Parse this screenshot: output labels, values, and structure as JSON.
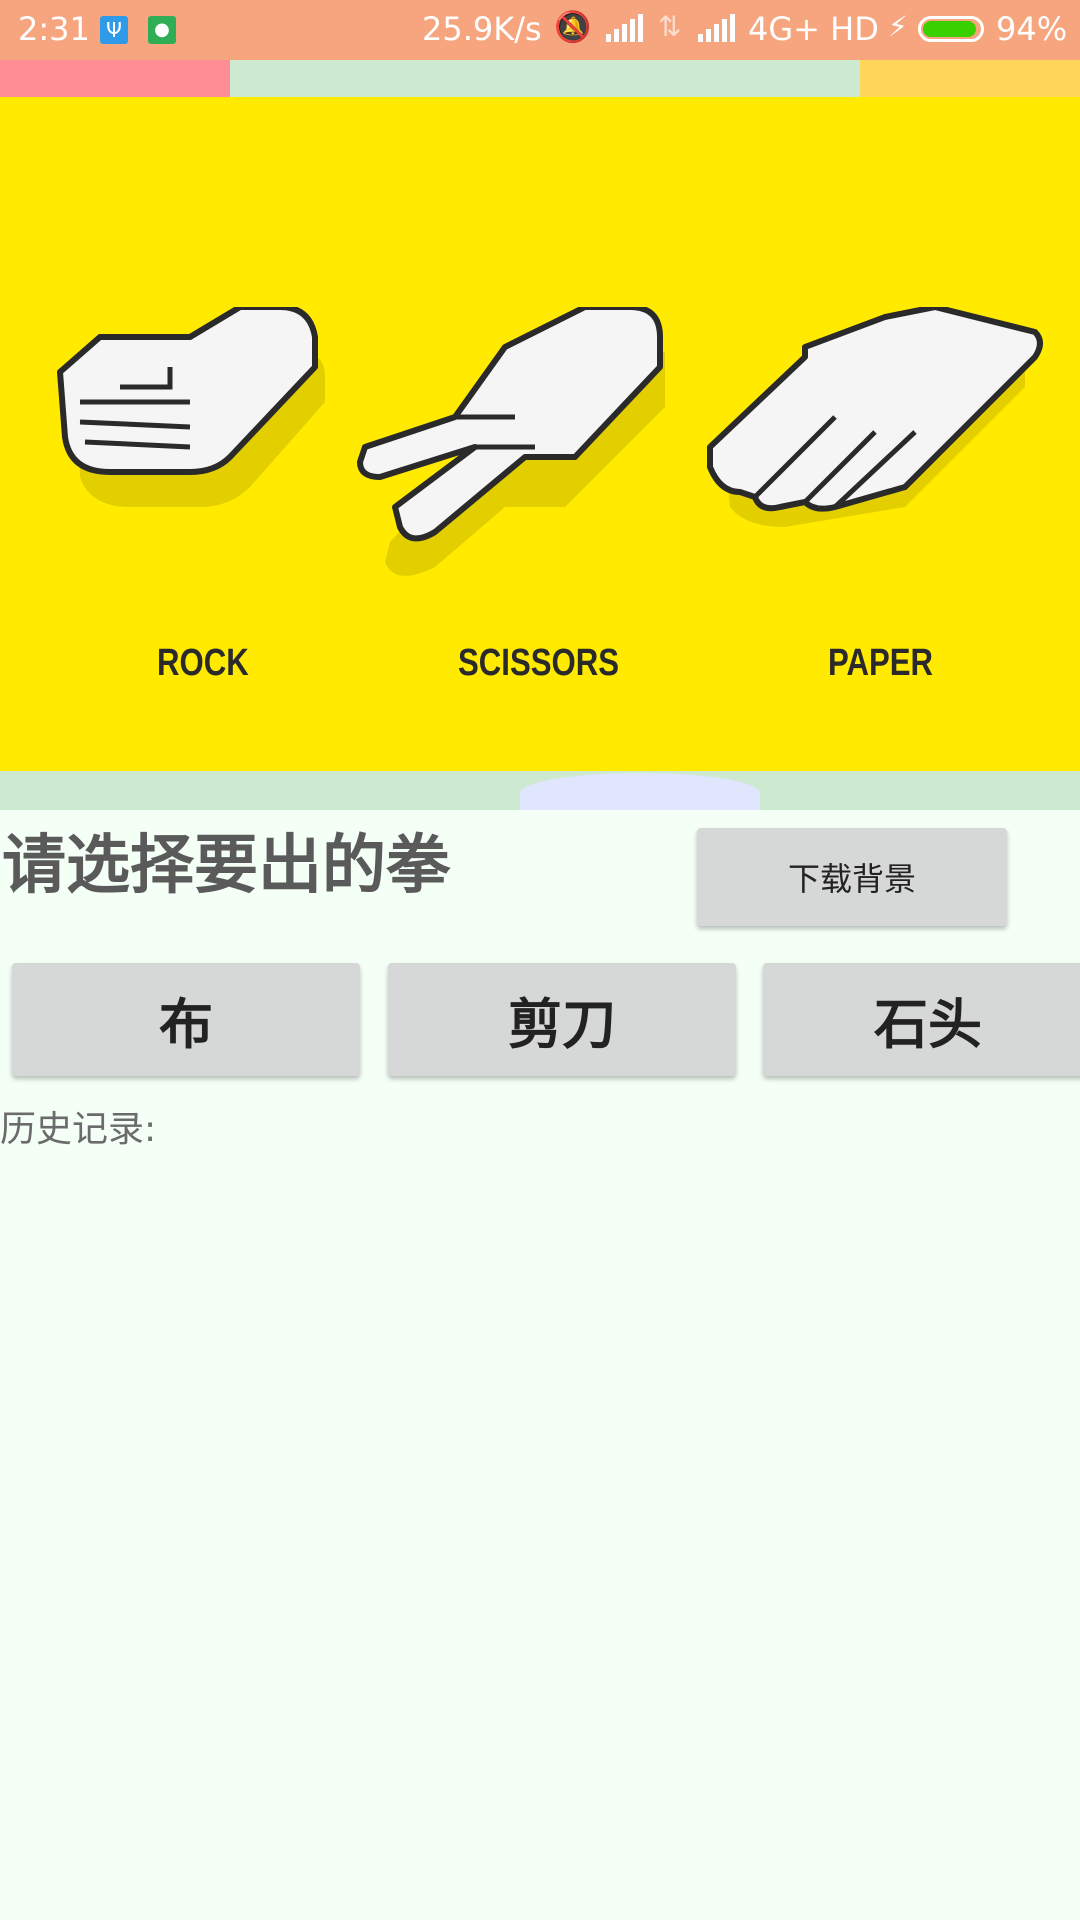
{
  "status_bar": {
    "time": "2:31",
    "speed": "25.9K/s",
    "network": "4G+ HD",
    "battery": "94%",
    "battery_level": 0.94,
    "icons": [
      "usb-icon",
      "android-icon",
      "mute-bell-icon",
      "signal-icon",
      "data-icon",
      "signal-icon",
      "charging-icon",
      "battery-icon"
    ]
  },
  "hero": {
    "labels": [
      "ROCK",
      "SCISSORS",
      "PAPER"
    ]
  },
  "prompt": "请选择要出的拳",
  "download_button": "下载背景",
  "choices": [
    "布",
    "剪刀",
    "石头"
  ],
  "history_label": "历史记录:",
  "colors": {
    "status_bar": "#f7a57f",
    "hero_bg": "#ffea00",
    "page_bg": "#f4fff6",
    "button_bg": "#d6d7d7"
  }
}
